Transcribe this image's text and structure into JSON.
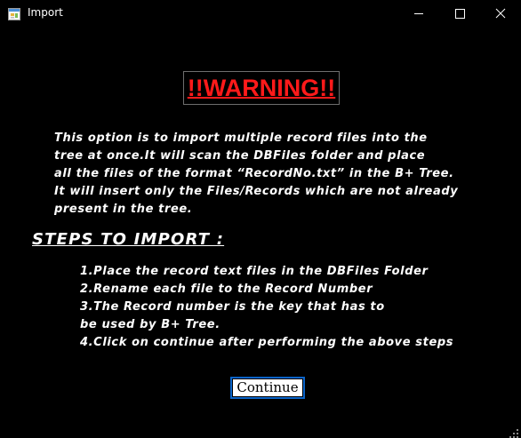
{
  "window": {
    "title": "Import",
    "app_icon": "form-icon",
    "controls": {
      "minimize": "minimize-icon",
      "maximize": "maximize-icon",
      "close": "close-icon"
    }
  },
  "warning": {
    "text": "!!WARNING!!",
    "color": "#ff1a1a"
  },
  "intro": {
    "lines": [
      "This option is to import multiple record files into the",
      "tree at once.It will scan the DBFiles folder and place",
      "all the files of the format “RecordNo.txt” in the B+ Tree.",
      "It will insert only the Files/Records which are not already",
      "present in the tree."
    ]
  },
  "steps": {
    "heading": "STEPS TO IMPORT :",
    "lines": [
      "1.Place the record text files in the DBFiles Folder",
      "2.Rename each file to the Record Number",
      "3.The Record number is the key that has to",
      "be used by B+ Tree.",
      "4.Click on continue after performing the above steps"
    ]
  },
  "continue_button": {
    "label": "Continue"
  },
  "colors": {
    "background": "#000000",
    "text": "#ffffff",
    "button_border": "#0a64c8"
  }
}
